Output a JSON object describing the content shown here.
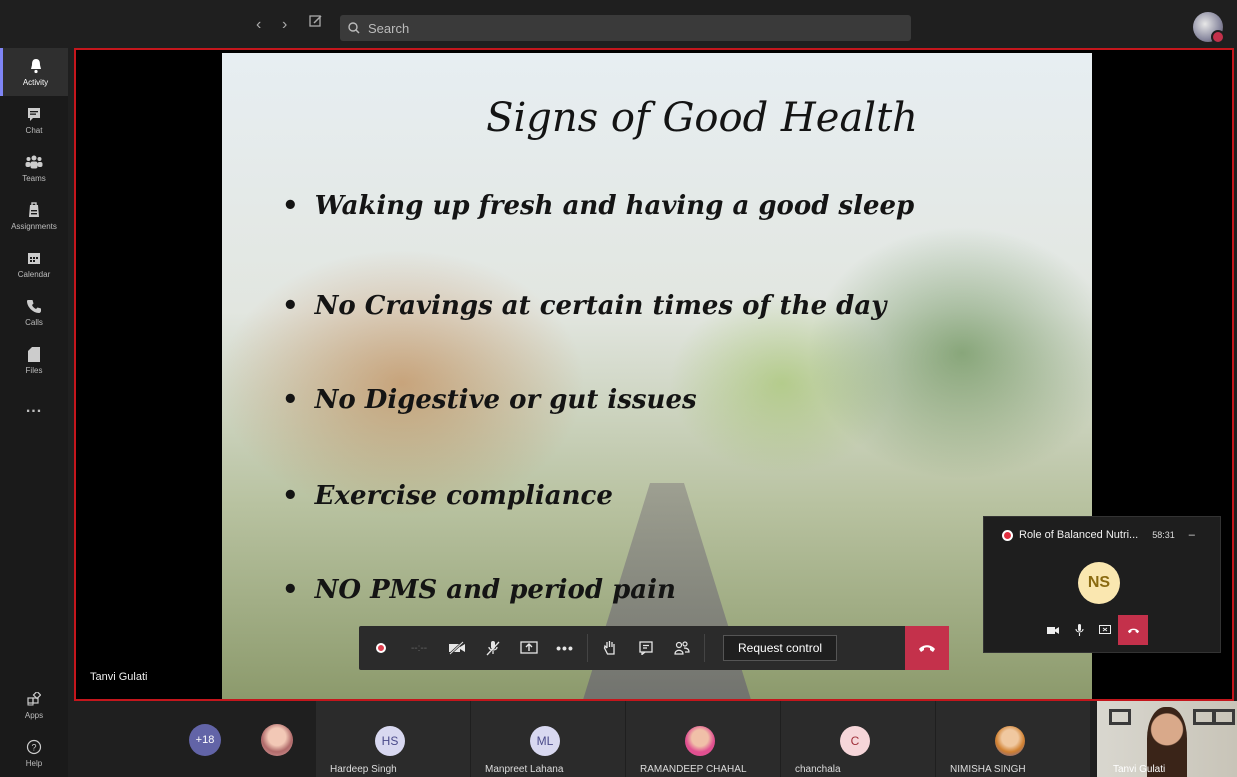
{
  "search": {
    "placeholder": "Search"
  },
  "rail": {
    "items": [
      {
        "label": "Activity",
        "icon": "bell-icon"
      },
      {
        "label": "Chat",
        "icon": "chat-icon"
      },
      {
        "label": "Teams",
        "icon": "teams-icon"
      },
      {
        "label": "Assignments",
        "icon": "assignments-icon"
      },
      {
        "label": "Calendar",
        "icon": "calendar-icon"
      },
      {
        "label": "Calls",
        "icon": "phone-icon"
      },
      {
        "label": "Files",
        "icon": "file-icon"
      }
    ],
    "more": "...",
    "apps": "Apps",
    "help": "Help"
  },
  "slide": {
    "title": "Signs of Good Health",
    "bullets": [
      "Waking up fresh and having a good sleep",
      "No Cravings at certain times of the day",
      "No Digestive or gut issues",
      "Exercise compliance",
      "NO PMS and period pain"
    ]
  },
  "presenter": {
    "name": "Tanvi Gulati"
  },
  "toolbar": {
    "timer": "--:--",
    "request_control": "Request control"
  },
  "mini": {
    "title": "Role of Balanced Nutri...",
    "time": "58:31",
    "initials": "NS"
  },
  "participants": {
    "overflow": "+18",
    "tiles": [
      {
        "name": "Hardeep Singh",
        "initials": "HS",
        "color": "#d8d8f0"
      },
      {
        "name": "Manpreet Lahana",
        "initials": "ML",
        "color": "#d8d8f0"
      },
      {
        "name": "RAMANDEEP CHAHAL",
        "initials": "",
        "color": "#e05090"
      },
      {
        "name": "chanchala",
        "initials": "C",
        "color": "#f6d6d9"
      },
      {
        "name": "NIMISHA SINGH",
        "initials": "",
        "color": "#d08030"
      }
    ],
    "self": "Tanvi Gulati"
  },
  "colors": {
    "accent": "#6264a7",
    "hangup": "#c4314b",
    "stage_border": "#c4161c"
  }
}
